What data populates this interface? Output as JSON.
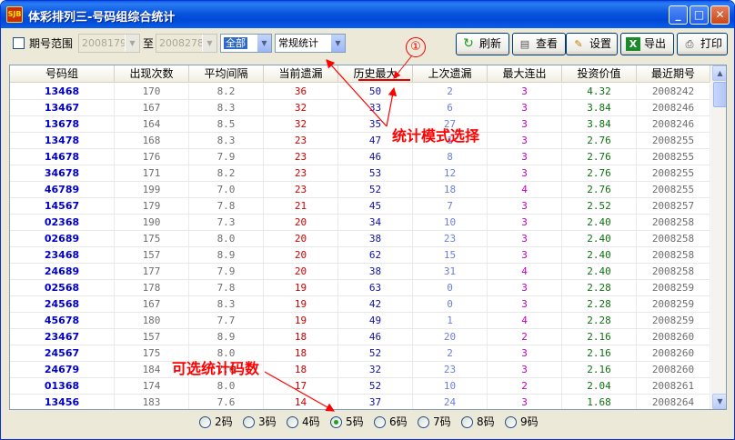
{
  "window": {
    "title": "体彩排列三-号码组综合统计",
    "app_icon": "SJB",
    "controls": [
      "_",
      "□",
      "✕"
    ]
  },
  "toolbar": {
    "period_range_label": "期号范围",
    "period_from": "2008179",
    "to_label": "至",
    "period_to": "2008278",
    "filter_select": "全部",
    "mode_select": "常规统计",
    "buttons": {
      "refresh": "刷新",
      "view": "查看",
      "settings": "设置",
      "export": "导出",
      "print": "打印"
    }
  },
  "table": {
    "columns": [
      "号码组",
      "出现次数",
      "平均间隔",
      "当前遗漏",
      "历史最大",
      "上次遗漏",
      "最大连出",
      "投资价值",
      "最近期号"
    ],
    "rows": [
      [
        "13468",
        "170",
        "8.2",
        "36",
        "50",
        "2",
        "3",
        "4.32",
        "2008242"
      ],
      [
        "13467",
        "167",
        "8.3",
        "32",
        "33",
        "6",
        "3",
        "3.84",
        "2008246"
      ],
      [
        "13678",
        "164",
        "8.5",
        "32",
        "35",
        "27",
        "3",
        "3.84",
        "2008246"
      ],
      [
        "13478",
        "168",
        "8.3",
        "23",
        "47",
        "1",
        "3",
        "2.76",
        "2008255"
      ],
      [
        "14678",
        "176",
        "7.9",
        "23",
        "46",
        "8",
        "3",
        "2.76",
        "2008255"
      ],
      [
        "34678",
        "171",
        "8.2",
        "23",
        "53",
        "12",
        "3",
        "2.76",
        "2008255"
      ],
      [
        "46789",
        "199",
        "7.0",
        "23",
        "52",
        "18",
        "4",
        "2.76",
        "2008255"
      ],
      [
        "14567",
        "179",
        "7.8",
        "21",
        "45",
        "7",
        "3",
        "2.52",
        "2008257"
      ],
      [
        "02368",
        "190",
        "7.3",
        "20",
        "34",
        "10",
        "3",
        "2.40",
        "2008258"
      ],
      [
        "02689",
        "175",
        "8.0",
        "20",
        "38",
        "23",
        "3",
        "2.40",
        "2008258"
      ],
      [
        "23468",
        "157",
        "8.9",
        "20",
        "62",
        "15",
        "3",
        "2.40",
        "2008258"
      ],
      [
        "24689",
        "177",
        "7.9",
        "20",
        "38",
        "31",
        "4",
        "2.40",
        "2008258"
      ],
      [
        "02568",
        "178",
        "7.8",
        "19",
        "63",
        "0",
        "3",
        "2.28",
        "2008259"
      ],
      [
        "24568",
        "167",
        "8.3",
        "19",
        "42",
        "0",
        "3",
        "2.28",
        "2008259"
      ],
      [
        "45678",
        "180",
        "7.7",
        "19",
        "49",
        "1",
        "4",
        "2.28",
        "2008259"
      ],
      [
        "23467",
        "157",
        "8.9",
        "18",
        "46",
        "20",
        "2",
        "2.16",
        "2008260"
      ],
      [
        "24567",
        "175",
        "8.0",
        "18",
        "52",
        "2",
        "3",
        "2.16",
        "2008260"
      ],
      [
        "24679",
        "184",
        "7.6",
        "18",
        "32",
        "23",
        "3",
        "2.16",
        "2008260"
      ],
      [
        "01368",
        "174",
        "8.0",
        "17",
        "52",
        "10",
        "2",
        "2.04",
        "2008261"
      ],
      [
        "13456",
        "183",
        "7.6",
        "14",
        "37",
        "24",
        "3",
        "1.68",
        "2008264"
      ]
    ]
  },
  "code_counts": {
    "options": [
      "2码",
      "3码",
      "4码",
      "5码",
      "6码",
      "7码",
      "8码",
      "9码"
    ],
    "selected": "5码"
  },
  "annotations": {
    "number": "①",
    "mode_hint": "统计模式选择",
    "count_hint": "可选统计码数"
  },
  "colors": {
    "annotation": "#ff0000",
    "group_text": "#0000c8",
    "current_miss": "#d00000",
    "invest_value": "#107010",
    "max_consecutive": "#c000c0"
  }
}
